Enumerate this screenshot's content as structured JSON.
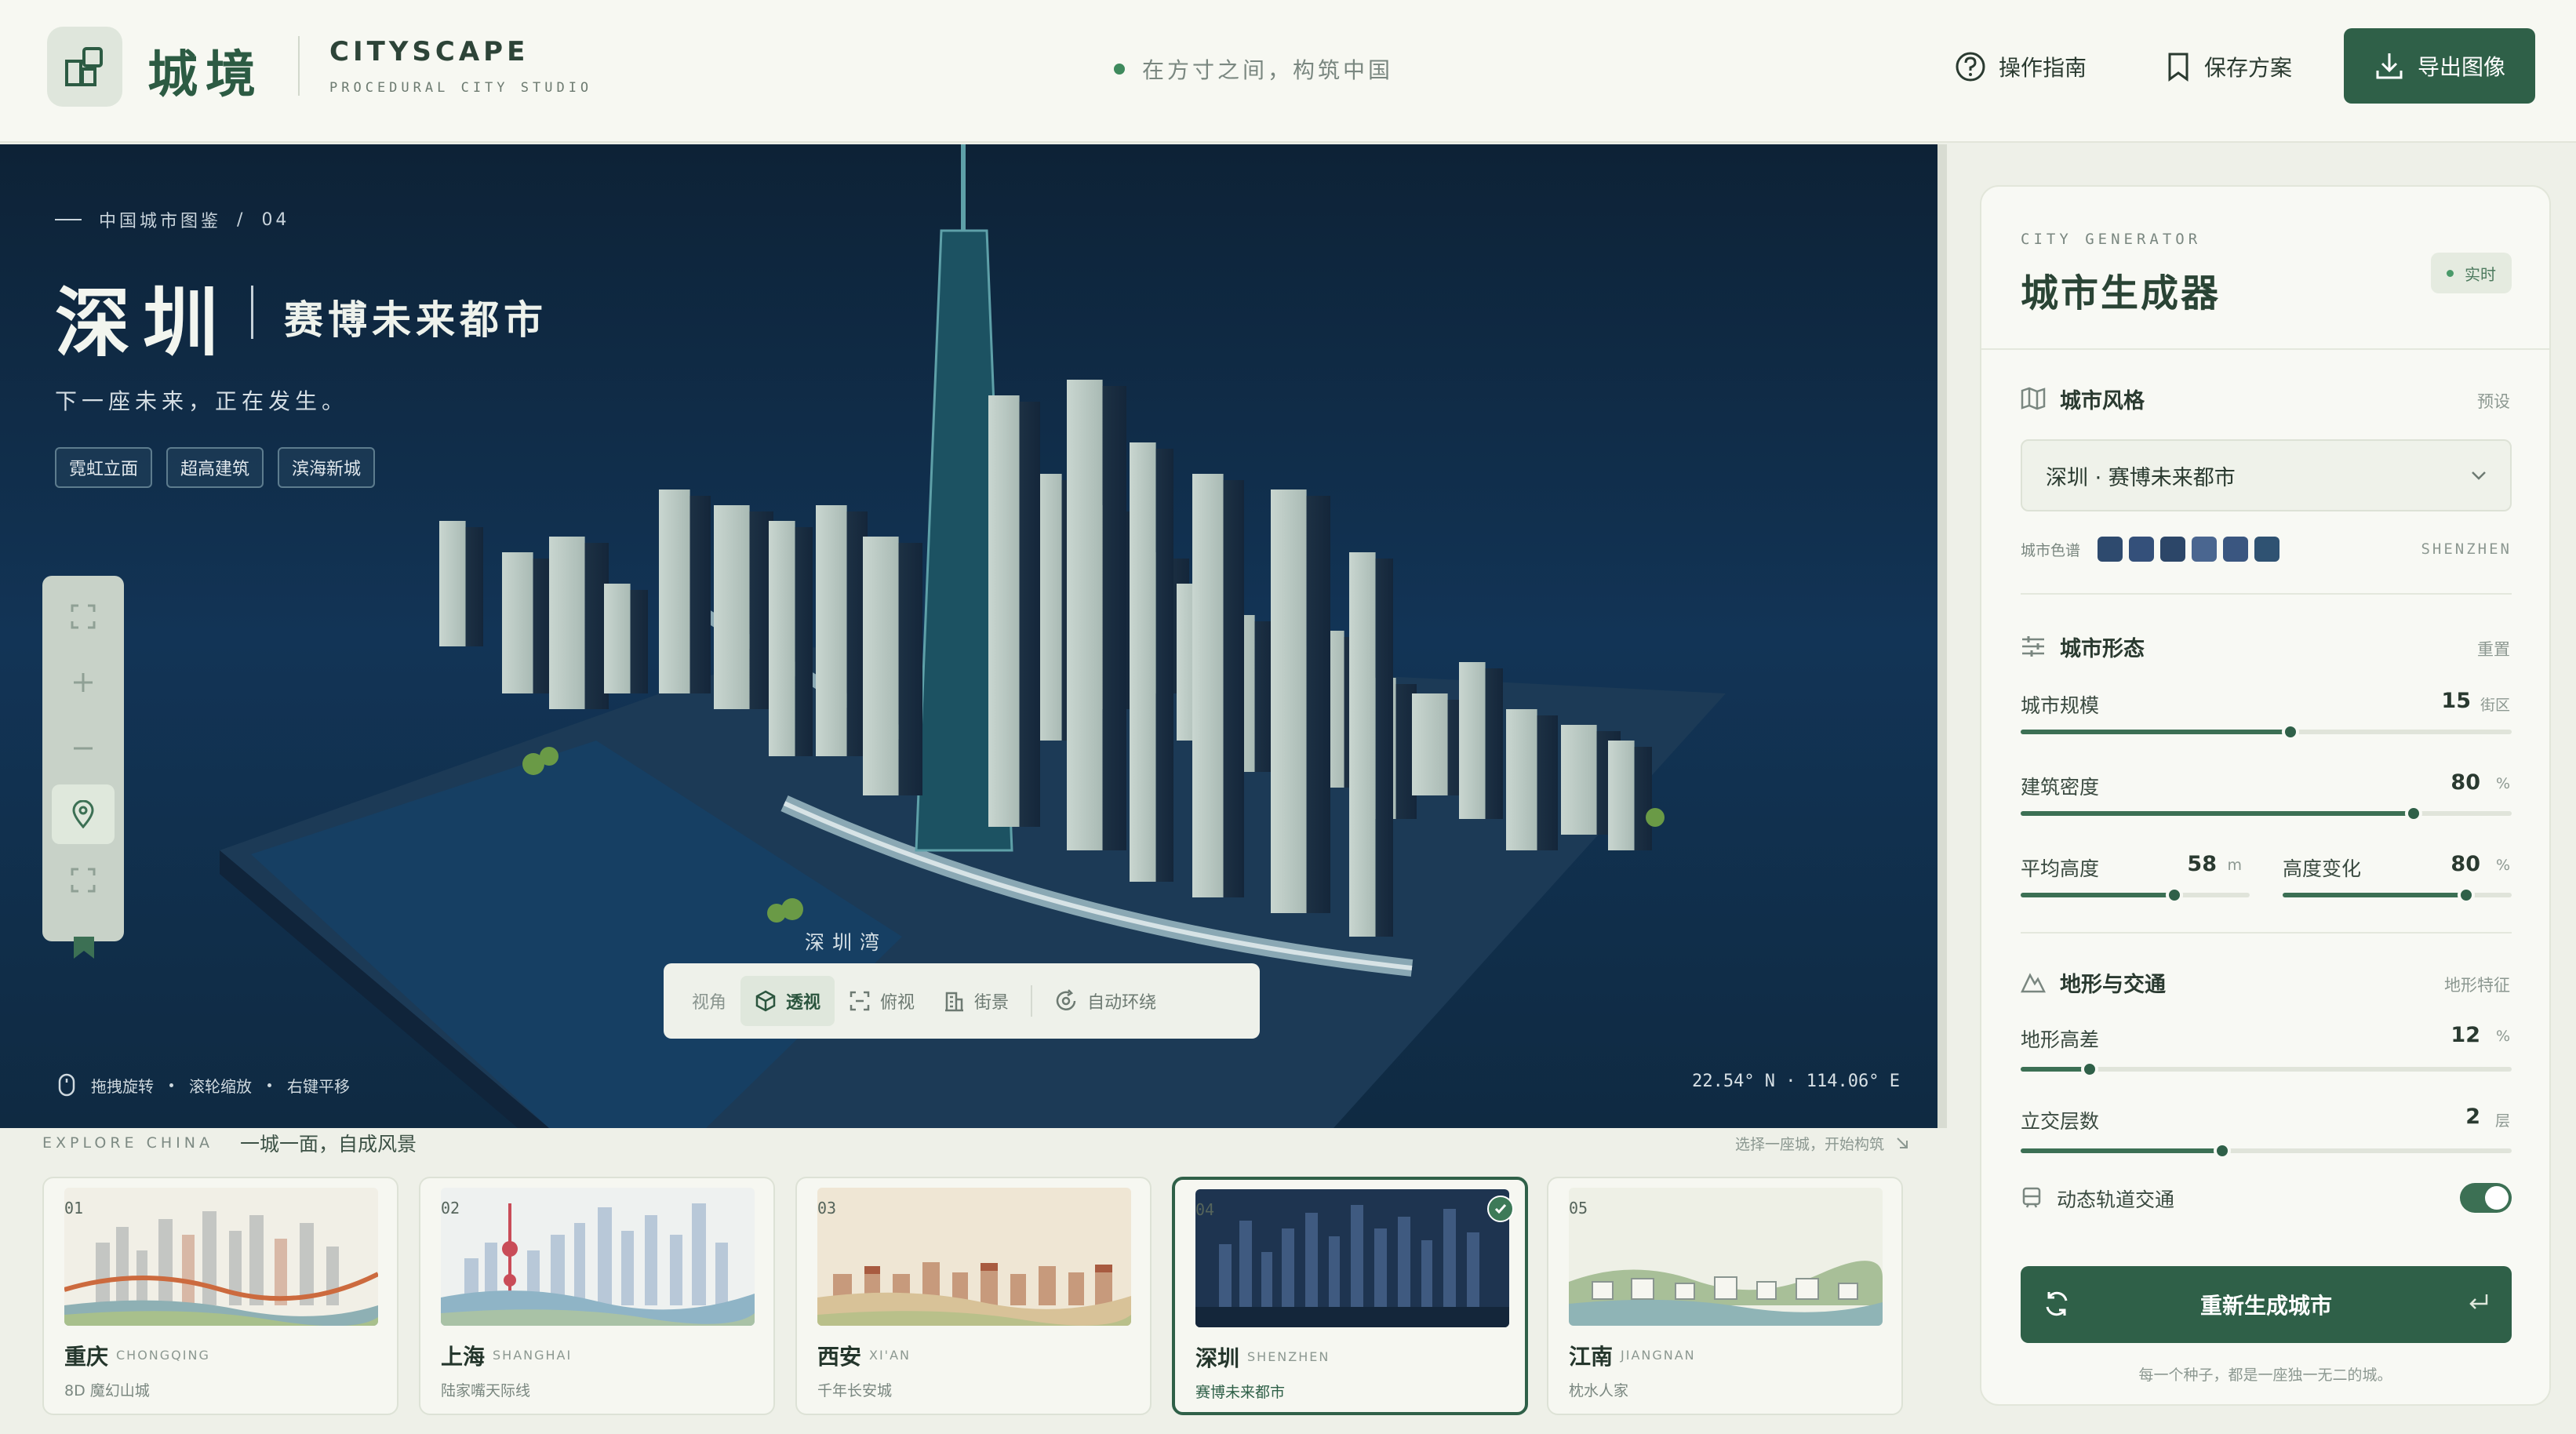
{
  "header": {
    "brand_cn": "城境",
    "brand_en": "CITYSCAPE",
    "brand_sub": "PROCEDURAL CITY STUDIO",
    "tagline": "在方寸之间，构筑中国",
    "guide_label": "操作指南",
    "save_label": "保存方案",
    "export_label": "导出图像",
    "accent_color": "#2f6048"
  },
  "scene": {
    "breadcrumb_section": "中国城市图鉴",
    "breadcrumb_sep": "/",
    "breadcrumb_index": "04",
    "city_name": "深圳",
    "city_subtitle": "赛博未来都市",
    "city_tagline": "下一座未来，正在发生。",
    "tags": [
      "霓虹立面",
      "超高建筑",
      "滨海新城"
    ],
    "bay_label": "深圳湾",
    "view_label": "视角",
    "views": [
      {
        "label": "透视",
        "icon": "cube-icon",
        "active": true
      },
      {
        "label": "俯视",
        "icon": "top-view-icon",
        "active": false
      },
      {
        "label": "街景",
        "icon": "street-view-icon",
        "active": false
      },
      {
        "label": "自动环绕",
        "icon": "orbit-icon",
        "active": false
      }
    ],
    "hints": [
      "拖拽旋转",
      "滚轮缩放",
      "右键平移"
    ],
    "coords": "22.54° N · 114.06° E",
    "map_tools": [
      "fullscreen-icon",
      "zoom-in-icon",
      "zoom-out-icon",
      "location-pin-icon",
      "fit-view-icon"
    ]
  },
  "explore": {
    "label_en": "EXPLORE CHINA",
    "label_cn": "一城一面，自成风景",
    "hint": "选择一座城，开始构筑",
    "cities": [
      {
        "num": "01",
        "name": "重庆",
        "en": "CHONGQING",
        "desc": "8D 魔幻山城",
        "selected": false
      },
      {
        "num": "02",
        "name": "上海",
        "en": "SHANGHAI",
        "desc": "陆家嘴天际线",
        "selected": false
      },
      {
        "num": "03",
        "name": "西安",
        "en": "XI'AN",
        "desc": "千年长安城",
        "selected": false
      },
      {
        "num": "04",
        "name": "深圳",
        "en": "SHENZHEN",
        "desc": "赛博未来都市",
        "selected": true
      },
      {
        "num": "05",
        "name": "江南",
        "en": "JIANGNAN",
        "desc": "枕水人家",
        "selected": false
      }
    ]
  },
  "panel": {
    "kicker": "CITY GENERATOR",
    "title": "城市生成器",
    "live_badge": "实时",
    "style_section": "城市风格",
    "style_link": "预设",
    "style_value": "深圳 · 赛博未来都市",
    "palette_label": "城市色谱",
    "palette_code": "SHENZHEN",
    "palette_colors": [
      "#2e4a6e",
      "#34507a",
      "#2c4668",
      "#4a6690",
      "#3a5680",
      "#2f5272"
    ],
    "form_section": "城市形态",
    "form_link": "重置",
    "scale": {
      "label": "城市规模",
      "value": "15",
      "unit": "街区",
      "fraction": 0.55
    },
    "density": {
      "label": "建筑密度",
      "value": "80",
      "unit": "%",
      "fraction": 0.8
    },
    "avg_height": {
      "label": "平均高度",
      "value": "58",
      "unit": "m",
      "fraction": 0.67
    },
    "height_var": {
      "label": "高度变化",
      "value": "80",
      "unit": "%",
      "fraction": 0.8
    },
    "terrain_section": "地形与交通",
    "terrain_link": "地形特征",
    "elevation": {
      "label": "地形高差",
      "value": "12",
      "unit": "%",
      "fraction": 0.14
    },
    "interchange": {
      "label": "立交层数",
      "value": "2",
      "unit": "层",
      "fraction": 0.41
    },
    "rail_label": "动态轨道交通",
    "rail_on": true,
    "regen_label": "重新生成城市",
    "footer": "每一个种子，都是一座独一无二的城。"
  }
}
